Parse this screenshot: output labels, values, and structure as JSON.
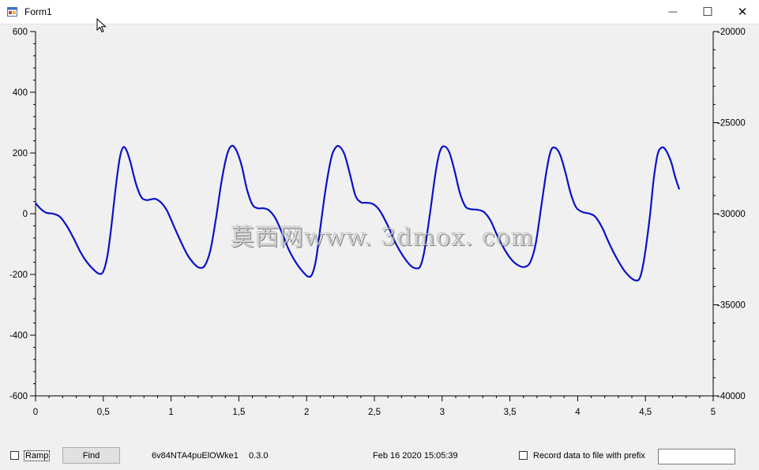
{
  "window": {
    "title": "Form1",
    "buttons": {
      "minimize": "—",
      "maximize": "☐",
      "close": "✕"
    }
  },
  "chart_data": {
    "type": "line",
    "title": "",
    "xlabel": "",
    "ylabel": "",
    "xlim": [
      0,
      5
    ],
    "ylim": [
      -600,
      600
    ],
    "y2lim": [
      -40000,
      -20000
    ],
    "x_ticks": [
      "0",
      "0,5",
      "1",
      "1,5",
      "2",
      "2,5",
      "3",
      "3,5",
      "4",
      "4,5",
      "5"
    ],
    "y_ticks": [
      "600",
      "400",
      "200",
      "0",
      "-200",
      "-400",
      "-600"
    ],
    "y2_ticks": [
      "-20000",
      "-25000",
      "-30000",
      "-35000",
      "-40000"
    ],
    "grid": false,
    "line_color": "#0a12c8",
    "series": [
      {
        "values": [
          [
            0.0,
            35
          ],
          [
            0.04,
            15
          ],
          [
            0.08,
            3
          ],
          [
            0.13,
            0
          ],
          [
            0.18,
            -10
          ],
          [
            0.23,
            -40
          ],
          [
            0.28,
            -80
          ],
          [
            0.33,
            -125
          ],
          [
            0.38,
            -160
          ],
          [
            0.43,
            -185
          ],
          [
            0.47,
            -198
          ],
          [
            0.5,
            -190
          ],
          [
            0.53,
            -140
          ],
          [
            0.56,
            -40
          ],
          [
            0.59,
            80
          ],
          [
            0.62,
            180
          ],
          [
            0.645,
            218
          ],
          [
            0.67,
            210
          ],
          [
            0.7,
            170
          ],
          [
            0.74,
            100
          ],
          [
            0.78,
            55
          ],
          [
            0.82,
            45
          ],
          [
            0.86,
            48
          ],
          [
            0.89,
            48
          ],
          [
            0.93,
            35
          ],
          [
            0.97,
            10
          ],
          [
            1.02,
            -40
          ],
          [
            1.07,
            -90
          ],
          [
            1.12,
            -135
          ],
          [
            1.17,
            -165
          ],
          [
            1.21,
            -178
          ],
          [
            1.25,
            -170
          ],
          [
            1.29,
            -120
          ],
          [
            1.33,
            -20
          ],
          [
            1.37,
            100
          ],
          [
            1.41,
            190
          ],
          [
            1.445,
            223
          ],
          [
            1.48,
            210
          ],
          [
            1.52,
            160
          ],
          [
            1.56,
            80
          ],
          [
            1.6,
            30
          ],
          [
            1.64,
            18
          ],
          [
            1.68,
            18
          ],
          [
            1.72,
            12
          ],
          [
            1.77,
            -15
          ],
          [
            1.82,
            -65
          ],
          [
            1.87,
            -120
          ],
          [
            1.92,
            -160
          ],
          [
            1.97,
            -190
          ],
          [
            2.01,
            -207
          ],
          [
            2.04,
            -200
          ],
          [
            2.07,
            -150
          ],
          [
            2.1,
            -50
          ],
          [
            2.14,
            80
          ],
          [
            2.18,
            180
          ],
          [
            2.21,
            215
          ],
          [
            2.24,
            222
          ],
          [
            2.28,
            195
          ],
          [
            2.32,
            130
          ],
          [
            2.36,
            60
          ],
          [
            2.4,
            38
          ],
          [
            2.44,
            36
          ],
          [
            2.49,
            32
          ],
          [
            2.54,
            10
          ],
          [
            2.6,
            -40
          ],
          [
            2.66,
            -100
          ],
          [
            2.72,
            -145
          ],
          [
            2.77,
            -172
          ],
          [
            2.81,
            -180
          ],
          [
            2.84,
            -172
          ],
          [
            2.87,
            -120
          ],
          [
            2.91,
            0
          ],
          [
            2.95,
            130
          ],
          [
            2.98,
            200
          ],
          [
            3.01,
            222
          ],
          [
            3.05,
            205
          ],
          [
            3.09,
            145
          ],
          [
            3.13,
            70
          ],
          [
            3.17,
            25
          ],
          [
            3.21,
            15
          ],
          [
            3.26,
            13
          ],
          [
            3.31,
            5
          ],
          [
            3.36,
            -25
          ],
          [
            3.41,
            -75
          ],
          [
            3.47,
            -125
          ],
          [
            3.52,
            -155
          ],
          [
            3.57,
            -172
          ],
          [
            3.61,
            -175
          ],
          [
            3.65,
            -160
          ],
          [
            3.69,
            -100
          ],
          [
            3.73,
            20
          ],
          [
            3.77,
            140
          ],
          [
            3.8,
            205
          ],
          [
            3.83,
            218
          ],
          [
            3.87,
            195
          ],
          [
            3.91,
            135
          ],
          [
            3.95,
            65
          ],
          [
            3.99,
            20
          ],
          [
            4.04,
            5
          ],
          [
            4.09,
            0
          ],
          [
            4.13,
            -10
          ],
          [
            4.18,
            -45
          ],
          [
            4.23,
            -95
          ],
          [
            4.28,
            -140
          ],
          [
            4.34,
            -185
          ],
          [
            4.39,
            -210
          ],
          [
            4.43,
            -220
          ],
          [
            4.46,
            -210
          ],
          [
            4.49,
            -150
          ],
          [
            4.53,
            -20
          ],
          [
            4.56,
            110
          ],
          [
            4.59,
            195
          ],
          [
            4.62,
            218
          ],
          [
            4.65,
            210
          ],
          [
            4.69,
            170
          ],
          [
            4.72,
            120
          ],
          [
            4.75,
            80
          ]
        ]
      }
    ]
  },
  "watermark": "莫西网www. 3dmox. com",
  "controls": {
    "ramp_label": "Ramp",
    "find_label": "Find",
    "device_id": "6v84NTA4puElOWke1",
    "version": "0.3.0",
    "build_date": "Feb 16 2020 15:05:39",
    "record_label": "Record data to file with prefix",
    "prefix_value": ""
  }
}
